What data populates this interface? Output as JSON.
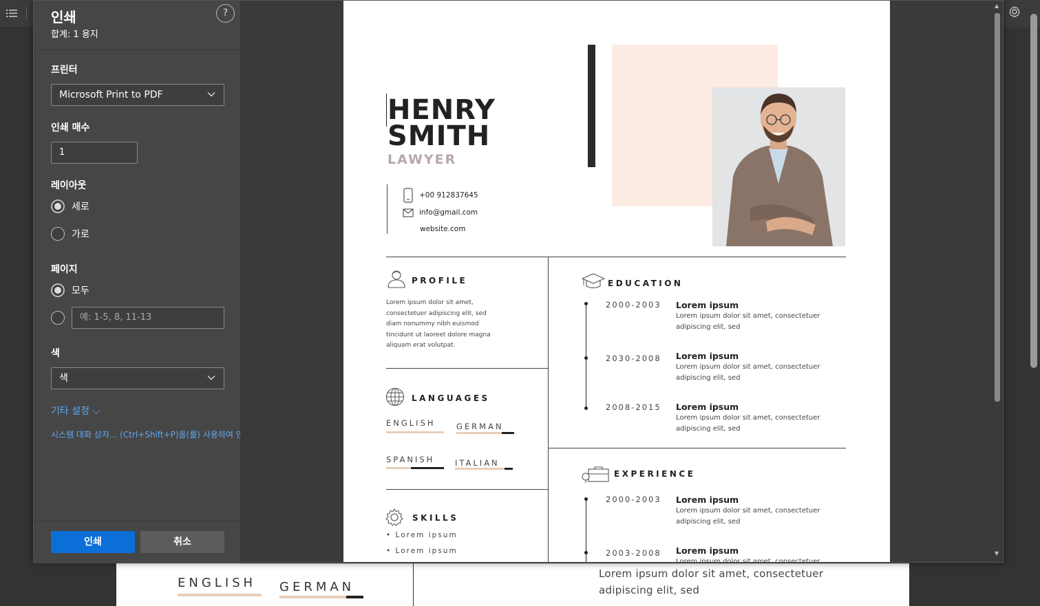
{
  "dialog": {
    "title": "인쇄",
    "subtitle": "합계: 1 용지",
    "help": "?"
  },
  "printer": {
    "label": "프린터",
    "value": "Microsoft Print to PDF"
  },
  "copies": {
    "label": "인쇄 매수",
    "value": "1"
  },
  "layout": {
    "label": "레이아웃",
    "options": [
      "세로",
      "가로"
    ],
    "selected": "세로"
  },
  "pages": {
    "label": "페이지",
    "options": [
      "모두"
    ],
    "range_placeholder": "예: 1-5, 8, 11-13",
    "selected": "모두"
  },
  "color": {
    "label": "색",
    "value": "색"
  },
  "more_settings": "기타 설정 ⌵",
  "system_dialog": "시스템 대화 상자... (Ctrl+Shift+P)을(를) 사용하여 인쇄",
  "buttons": {
    "print": "인쇄",
    "cancel": "취소"
  },
  "resume": {
    "first_name": "HENRY",
    "last_name": "SMITH",
    "job_title": "LAWYER",
    "contact": {
      "phone": "+00 912837645",
      "email": "info@gmail.com",
      "website": "website.com"
    },
    "profile": {
      "heading": "PROFILE",
      "lines": [
        "Lorem ipsum dolor sit amet,",
        "consectetuer adipiscing elit, sed",
        "diam nonummy nibh euismod",
        "tincidunt ut laoreet dolore magna",
        "aliquam erat volutpat."
      ]
    },
    "languages": {
      "heading": "LANGUAGES",
      "items": [
        {
          "name": "ENGLISH",
          "level": 1.0
        },
        {
          "name": "GERMAN",
          "level": 0.78
        },
        {
          "name": "SPANISH",
          "level": 0.45
        },
        {
          "name": "ITALIAN",
          "level": 0.85
        }
      ]
    },
    "skills": {
      "heading": "SKILLS",
      "items": [
        "• Lorem ipsum",
        "• Lorem ipsum"
      ]
    },
    "education": {
      "heading": "EDUCATION",
      "entries": [
        {
          "years": "2000-2003",
          "title": "Lorem ipsum",
          "desc1": "Lorem ipsum dolor sit amet, consectetuer",
          "desc2": "adipiscing elit, sed"
        },
        {
          "years": "2030-2008",
          "title": "Lorem ipsum",
          "desc1": "Lorem ipsum dolor sit amet, consectetuer",
          "desc2": "adipiscing elit, sed"
        },
        {
          "years": "2008-2015",
          "title": "Lorem ipsum",
          "desc1": "Lorem ipsum dolor sit amet, consectetuer",
          "desc2": "adipiscing elit, sed"
        }
      ]
    },
    "experience": {
      "heading": "EXPERIENCE",
      "entries": [
        {
          "years": "2000-2003",
          "title": "Lorem ipsum",
          "desc1": "Lorem ipsum dolor sit amet, consectetuer",
          "desc2": "adipiscing elit, sed"
        },
        {
          "years": "2003-2008",
          "title": "Lorem ipsum",
          "desc1": "Lorem ipsum dolor sit amet, consectetuer"
        }
      ]
    }
  },
  "background_doc": {
    "lang1": "ENGLISH",
    "lang2": "GERMAN",
    "line1": "Lorem ipsum dolor sit amet, consectetuer",
    "line2": "adipiscing elit, sed"
  },
  "colors": {
    "accent": "#0a6fd6",
    "link": "#5fa8f5",
    "resume_pink": "#fcebe2",
    "lang_bar_light": "#e8cdb8",
    "lang_bar_dark": "#222222"
  }
}
